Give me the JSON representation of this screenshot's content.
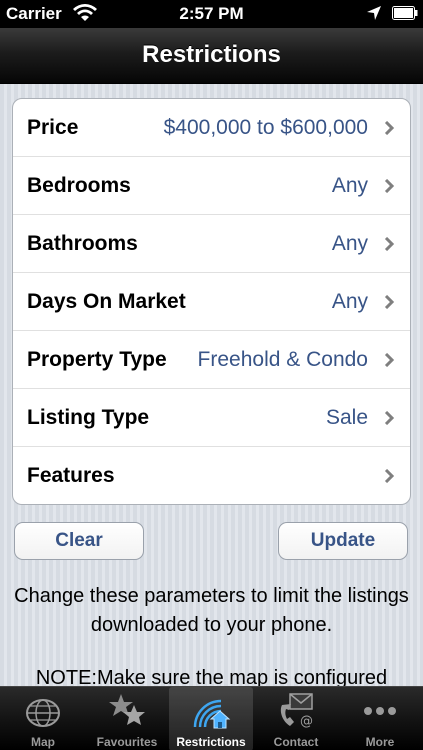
{
  "status_bar": {
    "carrier": "Carrier",
    "time": "2:57 PM"
  },
  "nav": {
    "title": "Restrictions"
  },
  "restrictions": [
    {
      "label": "Price",
      "value": "$400,000 to $600,000"
    },
    {
      "label": "Bedrooms",
      "value": "Any"
    },
    {
      "label": "Bathrooms",
      "value": "Any"
    },
    {
      "label": "Days On Market",
      "value": "Any"
    },
    {
      "label": "Property Type",
      "value": "Freehold & Condo"
    },
    {
      "label": "Listing Type",
      "value": "Sale"
    },
    {
      "label": "Features",
      "value": ""
    }
  ],
  "buttons": {
    "clear": "Clear",
    "update": "Update"
  },
  "info": {
    "line1": "Change these parameters to limit the listings downloaded to your phone.",
    "line2": "NOTE:Make sure the map is configured"
  },
  "tabs": [
    {
      "label": "Map",
      "icon": "globe-icon"
    },
    {
      "label": "Favourites",
      "icon": "stars-icon"
    },
    {
      "label": "Restrictions",
      "icon": "house-signal-icon",
      "selected": true
    },
    {
      "label": "Contact",
      "icon": "phone-mail-icon"
    },
    {
      "label": "More",
      "icon": "more-dots-icon"
    }
  ],
  "colors": {
    "value_blue": "#385487",
    "accent_blue": "#3ea6f0"
  }
}
